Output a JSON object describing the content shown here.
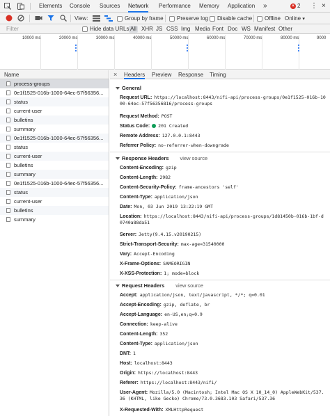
{
  "tabbar": {
    "tabs": [
      "Elements",
      "Console",
      "Sources",
      "Network",
      "Performance",
      "Memory",
      "Application"
    ],
    "more": "»",
    "error_count": "2",
    "kebab": "⋮"
  },
  "toolbar": {
    "view_label": "View:",
    "group_by_frame": "Group by frame",
    "preserve_log": "Preserve log",
    "disable_cache": "Disable cache",
    "offline": "Offline",
    "throttle": "Online"
  },
  "filterbar": {
    "placeholder": "Filter",
    "hide_data_urls": "Hide data URLs",
    "types": [
      "All",
      "XHR",
      "JS",
      "CSS",
      "Img",
      "Media",
      "Font",
      "Doc",
      "WS",
      "Manifest",
      "Other"
    ]
  },
  "timeline": {
    "ticks": [
      "10000 ms",
      "20000 ms",
      "30000 ms",
      "40000 ms",
      "50000 ms",
      "60000 ms",
      "70000 ms",
      "80000 ms",
      "9000"
    ]
  },
  "requests": {
    "header": "Name",
    "items": [
      "process-groups",
      "0e1f1525-016b-1000-64ec-57f56356...",
      "status",
      "current-user",
      "bulletins",
      "summary",
      "0e1f1525-016b-1000-64ec-57f56356...",
      "status",
      "current-user",
      "bulletins",
      "summary",
      "0e1f1525-016b-1000-64ec-57f56356...",
      "status",
      "current-user",
      "bulletins",
      "summary"
    ]
  },
  "details": {
    "close": "×",
    "tabs": [
      "Headers",
      "Preview",
      "Response",
      "Timing"
    ],
    "general": {
      "title": "General",
      "items": [
        {
          "k": "Request URL:",
          "v": "https://localhost:8443/nifi-api/process-groups/0e1f1525-016b-1000-64ec-57f56356816/process-groups"
        },
        {
          "k": "Request Method:",
          "v": "POST"
        },
        {
          "k": "Status Code:",
          "v": "201 Created"
        },
        {
          "k": "Remote Address:",
          "v": "127.0.0.1:8443"
        },
        {
          "k": "Referrer Policy:",
          "v": "no-referrer-when-downgrade"
        }
      ]
    },
    "response": {
      "title": "Response Headers",
      "view_source": "view source",
      "items": [
        {
          "k": "Content-Encoding:",
          "v": "gzip"
        },
        {
          "k": "Content-Length:",
          "v": "2982"
        },
        {
          "k": "Content-Security-Policy:",
          "v": "frame-ancestors 'self'"
        },
        {
          "k": "Content-Type:",
          "v": "application/json"
        },
        {
          "k": "Date:",
          "v": "Mon, 03 Jun 2019 13:22:19 GMT"
        },
        {
          "k": "Location:",
          "v": "https://localhost:8443/nifi-api/process-groups/1d81450b-016b-1bf-d0740a88da51"
        },
        {
          "k": "Server:",
          "v": "Jetty(9.4.15.v20190215)"
        },
        {
          "k": "Strict-Transport-Security:",
          "v": "max-age=31540000"
        },
        {
          "k": "Vary:",
          "v": "Accept-Encoding"
        },
        {
          "k": "X-Frame-Options:",
          "v": "SAMEORIGIN"
        },
        {
          "k": "X-XSS-Protection:",
          "v": "1; mode=block"
        }
      ]
    },
    "request": {
      "title": "Request Headers",
      "view_source": "view source",
      "items": [
        {
          "k": "Accept:",
          "v": "application/json, text/javascript, */*; q=0.01"
        },
        {
          "k": "Accept-Encoding:",
          "v": "gzip, deflate, br"
        },
        {
          "k": "Accept-Language:",
          "v": "en-US,en;q=0.9"
        },
        {
          "k": "Connection:",
          "v": "keep-alive"
        },
        {
          "k": "Content-Length:",
          "v": "352"
        },
        {
          "k": "Content-Type:",
          "v": "application/json"
        },
        {
          "k": "DNT:",
          "v": "1"
        },
        {
          "k": "Host:",
          "v": "localhost:8443"
        },
        {
          "k": "Origin:",
          "v": "https://localhost:8443"
        },
        {
          "k": "Referer:",
          "v": "https://localhost:8443/nifi/"
        },
        {
          "k": "User-Agent:",
          "v": "Mozilla/5.0 (Macintosh; Intel Mac OS X 10_14_0) AppleWebKit/537.36 (KHTML, like Gecko) Chrome/73.0.3683.103 Safari/537.36"
        },
        {
          "k": "X-Requested-With:",
          "v": "XMLHttpRequest"
        }
      ]
    }
  },
  "colors": {
    "accent": "#1a73e8",
    "record": "#d93025",
    "status_ok": "#0f9d58",
    "selected_row": "#dadce0"
  }
}
